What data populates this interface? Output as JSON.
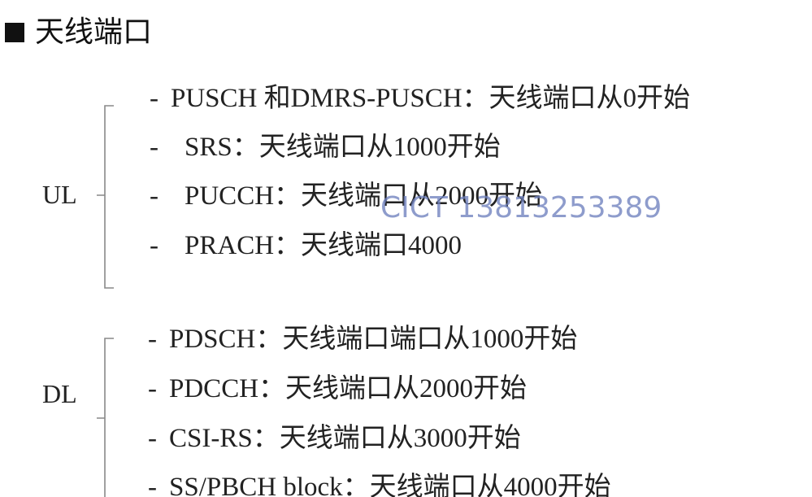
{
  "heading": {
    "title": "天线端口"
  },
  "ul": {
    "label": "UL",
    "items": [
      {
        "dash": "-",
        "text": "PUSCH 和DMRS-PUSCH：天线端口从0开始"
      },
      {
        "dash": "-",
        "text": "SRS：天线端口从1000开始"
      },
      {
        "dash": "-",
        "text": "PUCCH：天线端口从2000开始"
      },
      {
        "dash": "-",
        "text": "PRACH：天线端口4000"
      }
    ]
  },
  "dl": {
    "label": "DL",
    "items": [
      {
        "dash": "-",
        "text": "PDSCH：天线端口端口从1000开始"
      },
      {
        "dash": "-",
        "text": "PDCCH：天线端口从2000开始"
      },
      {
        "dash": "-",
        "text": "CSI-RS：天线端口从3000开始"
      },
      {
        "dash": "-",
        "text": "SS/PBCH block：天线端口从4000开始"
      }
    ]
  },
  "watermark": "CICT 13813253389",
  "colors": {
    "text": "#222222",
    "bracket": "#888888",
    "watermark": "#6e80be"
  }
}
